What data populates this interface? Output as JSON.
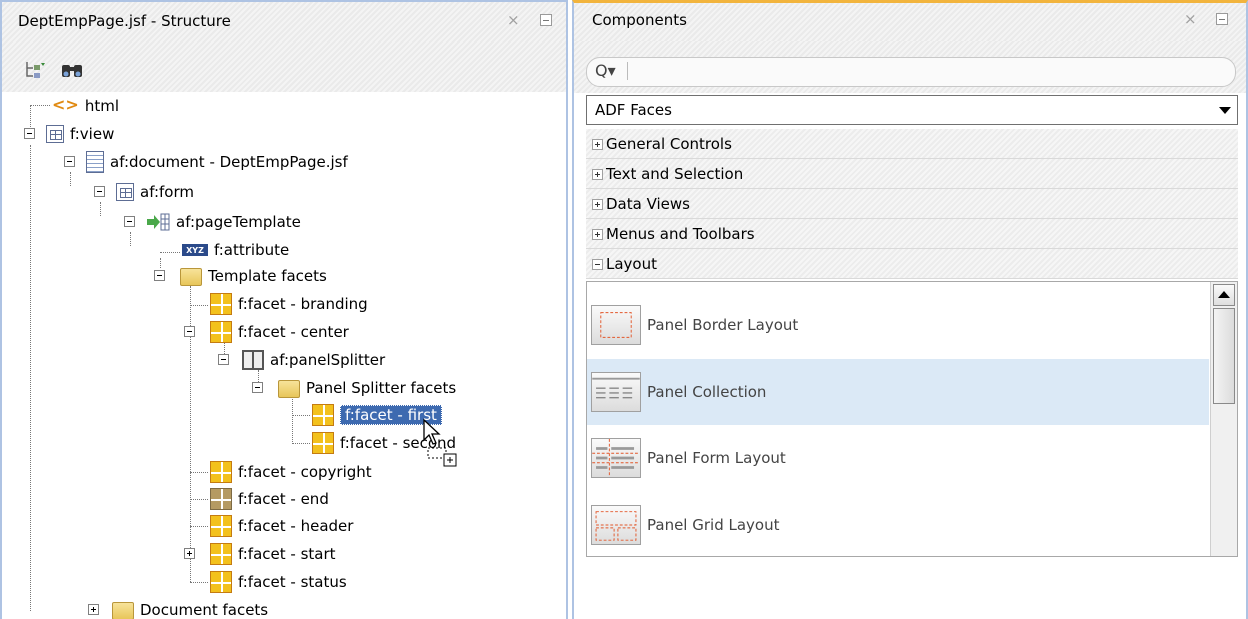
{
  "structure_panel": {
    "title": "DeptEmpPage.jsf - Structure",
    "close_glyph": "×",
    "toolbar_icons": [
      "show-attributes-icon",
      "find-binoculars-icon"
    ],
    "tree": {
      "html": "html",
      "f_view": "f:view",
      "af_document": "af:document - DeptEmpPage.jsf",
      "af_form": "af:form",
      "af_pageTemplate": "af:pageTemplate",
      "f_attribute": "f:attribute",
      "attribute_icon_text": "XYZ",
      "template_facets": "Template facets",
      "facet_branding": "f:facet - branding",
      "facet_center": "f:facet - center",
      "af_panelSplitter": "af:panelSplitter",
      "panel_splitter_facets": "Panel Splitter facets",
      "facet_first": "f:facet - first",
      "facet_second": "f:facet - second",
      "facet_copyright": "f:facet - copyright",
      "facet_end": "f:facet - end",
      "facet_header": "f:facet - header",
      "facet_start": "f:facet - start",
      "facet_status": "f:facet - status",
      "document_facets": "Document facets"
    }
  },
  "components_panel": {
    "title": "Components",
    "close_glyph": "×",
    "search": {
      "placeholder": "",
      "value": ""
    },
    "library_select": "ADF Faces",
    "categories": {
      "general_controls": "General Controls",
      "text_and_selection": "Text and Selection",
      "data_views": "Data Views",
      "menus_and_toolbars": "Menus and Toolbars",
      "layout": "Layout"
    },
    "layout_items": {
      "panel_border_layout": "Panel Border Layout",
      "panel_collection": "Panel Collection",
      "panel_form_layout": "Panel Form Layout",
      "panel_grid_layout": "Panel Grid Layout"
    }
  },
  "colors": {
    "selection": "#3d6ab0",
    "hover_row": "#dbe9f6",
    "panel_border": "#aec3e3",
    "active_tab_accent": "#f2b43d"
  }
}
